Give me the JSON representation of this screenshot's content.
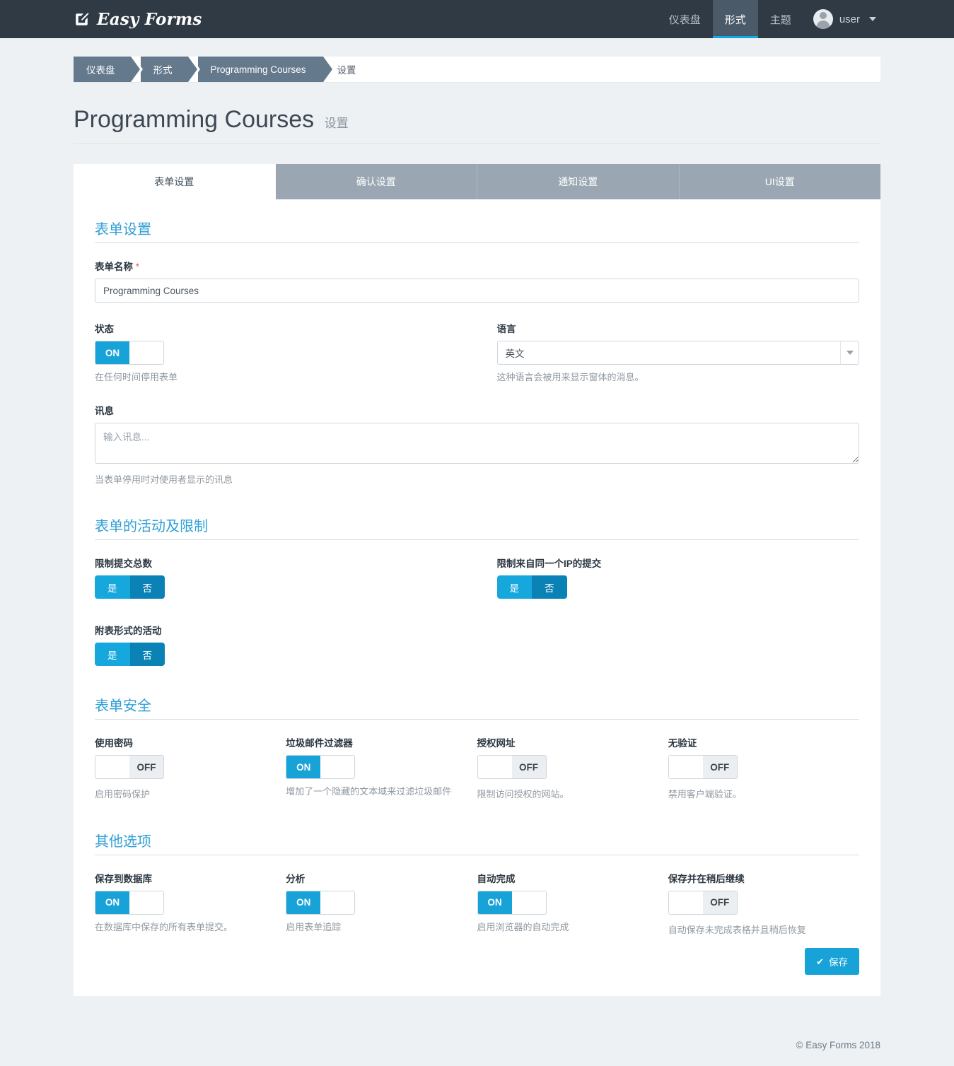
{
  "navbar": {
    "brand": "Easy Forms",
    "brand_icon": "pencil-square-icon",
    "items": [
      {
        "label": "仪表盘",
        "active": false
      },
      {
        "label": "形式",
        "active": true
      },
      {
        "label": "主题",
        "active": false
      }
    ],
    "user": "user"
  },
  "breadcrumb": {
    "items": [
      "仪表盘",
      "形式",
      "Programming Courses"
    ],
    "current": "设置"
  },
  "header": {
    "title": "Programming Courses",
    "subtitle": "设置"
  },
  "tabs": [
    {
      "label": "表单设置",
      "active": true
    },
    {
      "label": "确认设置",
      "active": false
    },
    {
      "label": "通知设置",
      "active": false
    },
    {
      "label": "UI设置",
      "active": false
    }
  ],
  "sections": {
    "form_settings": {
      "title": "表单设置",
      "form_name": {
        "label": "表单名称",
        "required_mark": "*",
        "value": "Programming Courses"
      },
      "status": {
        "label": "状态",
        "on": "ON",
        "off": "OFF",
        "state": "on",
        "help": "在任何时间停用表单"
      },
      "language": {
        "label": "语言",
        "value": "英文",
        "help": "这种语言会被用来显示窗体的消息。"
      },
      "message": {
        "label": "讯息",
        "value": "",
        "placeholder": "输入讯息...",
        "help": "当表单停用时对使用者显示的讯息"
      }
    },
    "activity_limits": {
      "title": "表单的活动及限制",
      "yes_label": "是",
      "no_label": "否",
      "items": [
        {
          "label": "限制提交总数",
          "selected": "no"
        },
        {
          "label": "限制来自同一个IP的提交",
          "selected": "no"
        },
        {
          "label": "附表形式的活动",
          "selected": "no"
        }
      ]
    },
    "form_security": {
      "title": "表单安全",
      "items": [
        {
          "label": "使用密码",
          "state": "off",
          "on": "ON",
          "off": "OFF",
          "help": "启用密码保护"
        },
        {
          "label": "垃圾邮件过滤器",
          "state": "on",
          "on": "ON",
          "off": "OFF",
          "help": "增加了一个隐藏的文本域来过滤垃圾邮件"
        },
        {
          "label": "授权网址",
          "state": "off",
          "on": "ON",
          "off": "OFF",
          "help": "限制访问授权的网站。"
        },
        {
          "label": "无验证",
          "state": "off",
          "on": "ON",
          "off": "OFF",
          "help": "禁用客户端验证。"
        }
      ]
    },
    "other_options": {
      "title": "其他选项",
      "items": [
        {
          "label": "保存到数据库",
          "state": "on",
          "on": "ON",
          "off": "OFF",
          "help": "在数据库中保存的所有表单提交。"
        },
        {
          "label": "分析",
          "state": "on",
          "on": "ON",
          "off": "OFF",
          "help": "启用表单追踪"
        },
        {
          "label": "自动完成",
          "state": "on",
          "on": "ON",
          "off": "OFF",
          "help": "启用浏览器的自动完成"
        },
        {
          "label": "保存并在稍后继续",
          "state": "off",
          "on": "ON",
          "off": "OFF",
          "help": "自动保存未完成表格并且稍后恢复"
        }
      ]
    }
  },
  "save_button": {
    "label": "保存",
    "icon": "check-icon"
  },
  "footer": {
    "text": "© Easy Forms 2018"
  },
  "colors": {
    "navbar_bg": "#2f3a45",
    "accent": "#17a2d8",
    "section_title": "#2f9fd6",
    "breadcrumb_bg": "#64798c",
    "tab_inactive_bg": "#9aa7b3",
    "yes_bg": "#16a7dd",
    "no_bg": "#0b82b5",
    "required": "#e8596b",
    "page_bg": "#edf1f4"
  }
}
